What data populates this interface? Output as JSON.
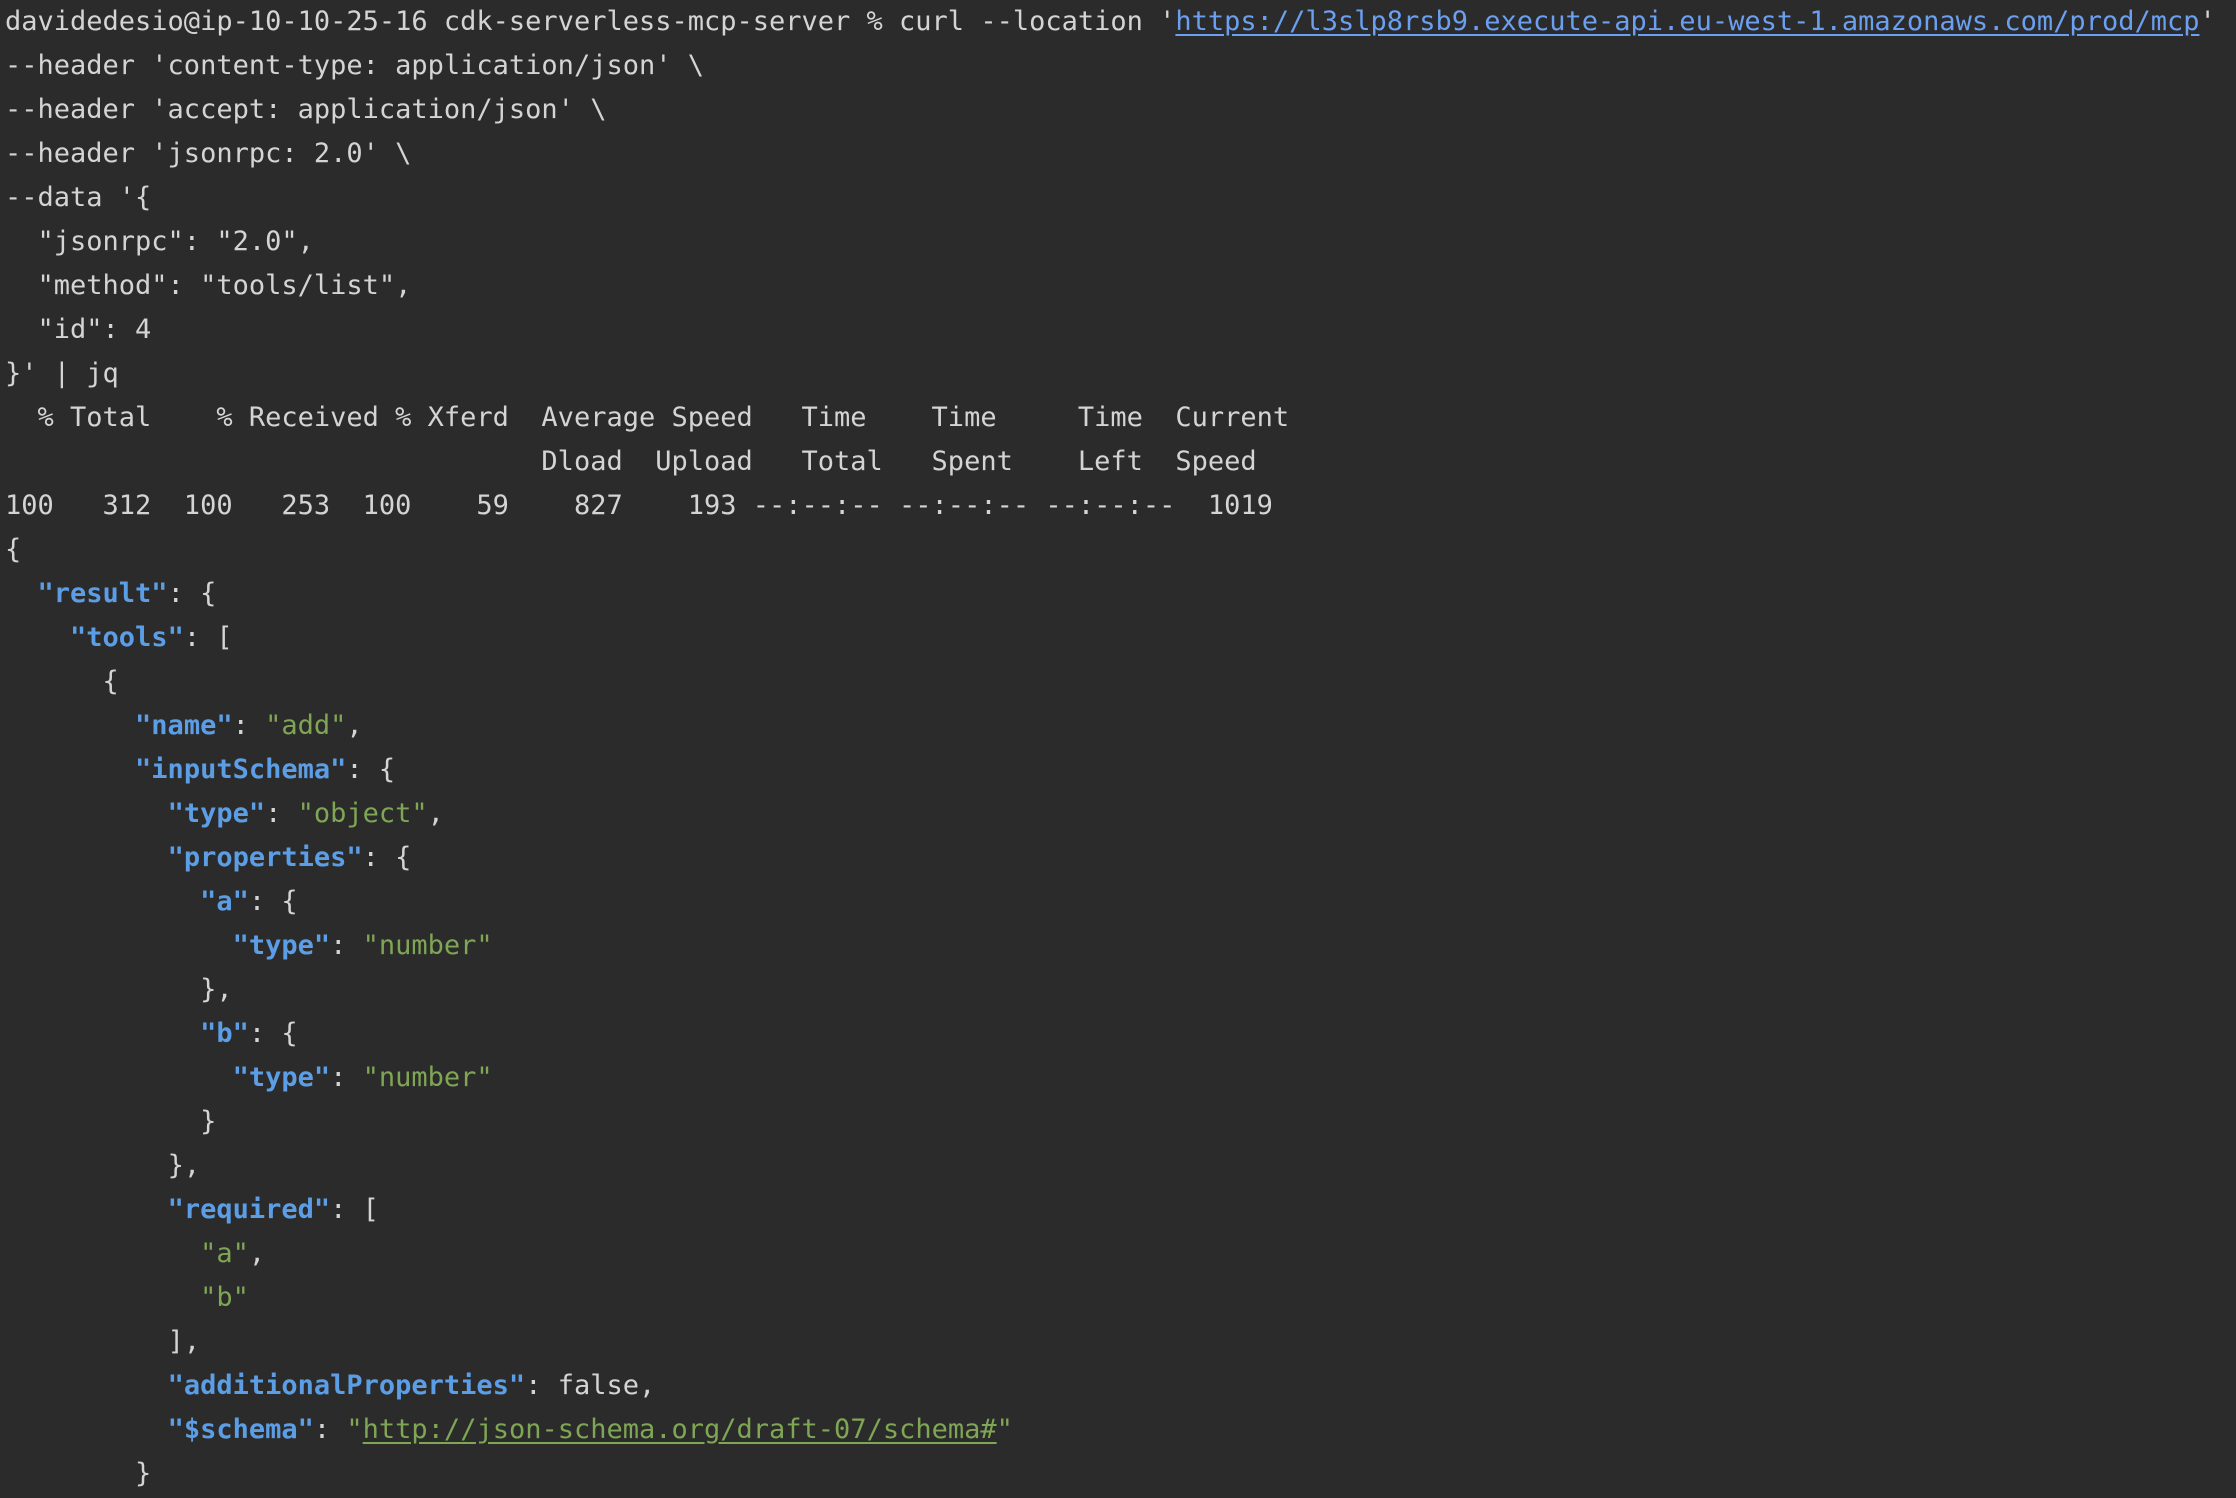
{
  "terminal": {
    "lines": [
      [
        {
          "t": "plain",
          "v": "davidedesio@ip-10-10-25-16 cdk-serverless-mcp-server % curl --location '"
        },
        {
          "t": "link",
          "v": "https://l3slp8rsb9.execute-api.eu-west-1.amazonaws.com/prod/mcp"
        },
        {
          "t": "plain",
          "v": "' \\"
        }
      ],
      [
        {
          "t": "plain",
          "v": "--header 'content-type: application/json' \\"
        }
      ],
      [
        {
          "t": "plain",
          "v": "--header 'accept: application/json' \\"
        }
      ],
      [
        {
          "t": "plain",
          "v": "--header 'jsonrpc: 2.0' \\"
        }
      ],
      [
        {
          "t": "plain",
          "v": "--data '{"
        }
      ],
      [
        {
          "t": "plain",
          "v": "  \"jsonrpc\": \"2.0\","
        }
      ],
      [
        {
          "t": "plain",
          "v": "  \"method\": \"tools/list\","
        }
      ],
      [
        {
          "t": "plain",
          "v": "  \"id\": 4"
        }
      ],
      [
        {
          "t": "plain",
          "v": "}' | jq"
        }
      ],
      [
        {
          "t": "plain",
          "v": "  % Total    % Received % Xferd  Average Speed   Time    Time     Time  Current"
        }
      ],
      [
        {
          "t": "plain",
          "v": "                                 Dload  Upload   Total   Spent    Left  Speed"
        }
      ],
      [
        {
          "t": "plain",
          "v": "100   312  100   253  100    59    827    193 --:--:-- --:--:-- --:--:--  1019"
        }
      ],
      [
        {
          "t": "punct",
          "v": "{"
        }
      ],
      [
        {
          "t": "plain",
          "v": "  "
        },
        {
          "t": "key",
          "v": "\"result\""
        },
        {
          "t": "punct",
          "v": ": {"
        }
      ],
      [
        {
          "t": "plain",
          "v": "    "
        },
        {
          "t": "key",
          "v": "\"tools\""
        },
        {
          "t": "punct",
          "v": ": ["
        }
      ],
      [
        {
          "t": "plain",
          "v": "      "
        },
        {
          "t": "punct",
          "v": "{"
        }
      ],
      [
        {
          "t": "plain",
          "v": "        "
        },
        {
          "t": "key",
          "v": "\"name\""
        },
        {
          "t": "punct",
          "v": ": "
        },
        {
          "t": "str",
          "v": "\"add\""
        },
        {
          "t": "punct",
          "v": ","
        }
      ],
      [
        {
          "t": "plain",
          "v": "        "
        },
        {
          "t": "key",
          "v": "\"inputSchema\""
        },
        {
          "t": "punct",
          "v": ": {"
        }
      ],
      [
        {
          "t": "plain",
          "v": "          "
        },
        {
          "t": "key",
          "v": "\"type\""
        },
        {
          "t": "punct",
          "v": ": "
        },
        {
          "t": "str",
          "v": "\"object\""
        },
        {
          "t": "punct",
          "v": ","
        }
      ],
      [
        {
          "t": "plain",
          "v": "          "
        },
        {
          "t": "key",
          "v": "\"properties\""
        },
        {
          "t": "punct",
          "v": ": {"
        }
      ],
      [
        {
          "t": "plain",
          "v": "            "
        },
        {
          "t": "key",
          "v": "\"a\""
        },
        {
          "t": "punct",
          "v": ": {"
        }
      ],
      [
        {
          "t": "plain",
          "v": "              "
        },
        {
          "t": "key",
          "v": "\"type\""
        },
        {
          "t": "punct",
          "v": ": "
        },
        {
          "t": "str",
          "v": "\"number\""
        }
      ],
      [
        {
          "t": "plain",
          "v": "            "
        },
        {
          "t": "punct",
          "v": "},"
        }
      ],
      [
        {
          "t": "plain",
          "v": "            "
        },
        {
          "t": "key",
          "v": "\"b\""
        },
        {
          "t": "punct",
          "v": ": {"
        }
      ],
      [
        {
          "t": "plain",
          "v": "              "
        },
        {
          "t": "key",
          "v": "\"type\""
        },
        {
          "t": "punct",
          "v": ": "
        },
        {
          "t": "str",
          "v": "\"number\""
        }
      ],
      [
        {
          "t": "plain",
          "v": "            "
        },
        {
          "t": "punct",
          "v": "}"
        }
      ],
      [
        {
          "t": "plain",
          "v": "          "
        },
        {
          "t": "punct",
          "v": "},"
        }
      ],
      [
        {
          "t": "plain",
          "v": "          "
        },
        {
          "t": "key",
          "v": "\"required\""
        },
        {
          "t": "punct",
          "v": ": ["
        }
      ],
      [
        {
          "t": "plain",
          "v": "            "
        },
        {
          "t": "str",
          "v": "\"a\""
        },
        {
          "t": "punct",
          "v": ","
        }
      ],
      [
        {
          "t": "plain",
          "v": "            "
        },
        {
          "t": "str",
          "v": "\"b\""
        }
      ],
      [
        {
          "t": "plain",
          "v": "          "
        },
        {
          "t": "punct",
          "v": "],"
        }
      ],
      [
        {
          "t": "plain",
          "v": "          "
        },
        {
          "t": "key",
          "v": "\"additionalProperties\""
        },
        {
          "t": "punct",
          "v": ": false,"
        }
      ],
      [
        {
          "t": "plain",
          "v": "          "
        },
        {
          "t": "key",
          "v": "\"$schema\""
        },
        {
          "t": "punct",
          "v": ": "
        },
        {
          "t": "str",
          "v": "\""
        },
        {
          "t": "linkgreen",
          "v": "http://json-schema.org/draft-07/schema#"
        },
        {
          "t": "str",
          "v": "\""
        }
      ],
      [
        {
          "t": "plain",
          "v": "        "
        },
        {
          "t": "punct",
          "v": "}"
        }
      ]
    ]
  },
  "colors": {
    "background": "#2b2b2b",
    "text": "#d4d4d4",
    "json_key": "#5c9ee6",
    "json_string": "#7fa654",
    "link": "#6b9ff0"
  }
}
